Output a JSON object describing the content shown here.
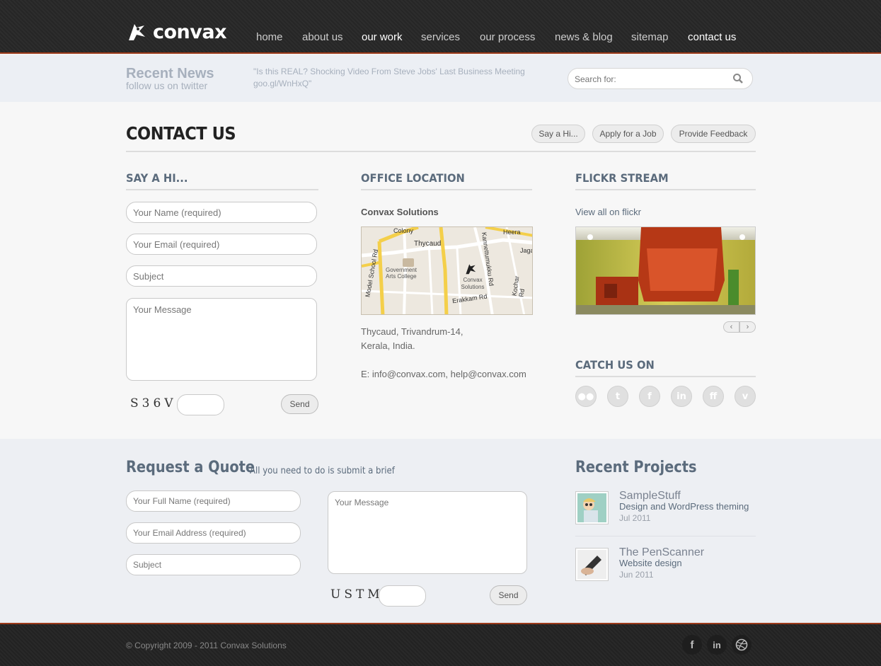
{
  "header": {
    "logo_text": "convax",
    "nav": [
      {
        "label": "home",
        "active": false
      },
      {
        "label": "about us",
        "active": false
      },
      {
        "label": "our work",
        "active": true
      },
      {
        "label": "services",
        "active": false
      },
      {
        "label": "our process",
        "active": false
      },
      {
        "label": "news & blog",
        "active": false
      },
      {
        "label": "sitemap",
        "active": false
      },
      {
        "label": "contact us",
        "active": true
      }
    ]
  },
  "newsbar": {
    "title": "Recent News",
    "subtitle": "follow us on twitter",
    "tweet": "\"Is this REAL? Shocking Video From Steve Jobs' Last Business Meeting goo.gl/WnHxQ\"",
    "search_placeholder": "Search for:"
  },
  "page": {
    "title": "CONTACT US",
    "buttons": [
      "Say a Hi...",
      "Apply for a Job",
      "Provide Feedback"
    ]
  },
  "say_hi": {
    "heading": "SAY A HI...",
    "name_placeholder": "Your Name (required)",
    "email_placeholder": "Your Email (required)",
    "subject_placeholder": "Subject",
    "message_placeholder": "Your Message",
    "captcha": "S36V",
    "send_label": "Send"
  },
  "office": {
    "heading": "OFFICE LOCATION",
    "company": "Convax Solutions",
    "map_labels": {
      "colony": "Colony",
      "thycaud": "Thycaud",
      "heera": "Heera",
      "jaga": "Jaga",
      "model_school": "Model School Rd",
      "kannettumukku": "Kannettumukku Rd",
      "kochar": "Kochar Rd",
      "erakkam": "Erakkam Rd",
      "gov_college": "Government Arts College",
      "convax": "Convax Solutions"
    },
    "address_line1": "Thycaud, Trivandrum-14,",
    "address_line2": "Kerala, India.",
    "email_line": "E: info@convax.com, help@convax.com"
  },
  "flickr": {
    "heading": "FLICKR STREAM",
    "link": "View all on flickr",
    "prev_icon": "chevron-left-icon",
    "next_icon": "chevron-right-icon"
  },
  "catch_us": {
    "heading": "CATCH US ON",
    "icons": [
      "flickr-icon",
      "twitter-icon",
      "facebook-icon",
      "linkedin-icon",
      "friendfeed-icon",
      "vimeo-icon"
    ]
  },
  "quote": {
    "title": "Request a Quote",
    "subtitle": "All you need to do is submit a brief",
    "fullname_placeholder": "Your Full Name (required)",
    "email_placeholder": "Your Email Address (required)",
    "subject_placeholder": "Subject",
    "message_placeholder": "Your Message",
    "captcha": "USTM",
    "send_label": "Send"
  },
  "recent_projects": {
    "title": "Recent Projects",
    "items": [
      {
        "name": "SampleStuff",
        "desc": "Design and WordPress theming",
        "date": "Jul 2011"
      },
      {
        "name": "The PenScanner",
        "desc": "Website design",
        "date": "Jun 2011"
      }
    ]
  },
  "footer": {
    "copyright": "© Copyright 2009 - 2011 Convax Solutions",
    "icons": [
      "facebook-icon",
      "linkedin-icon",
      "dribbble-icon"
    ]
  },
  "colors": {
    "header_bg": "#2a2a2a",
    "accent_line": "#9c3a1a",
    "heading_blue_gray": "#5b6b7c"
  }
}
